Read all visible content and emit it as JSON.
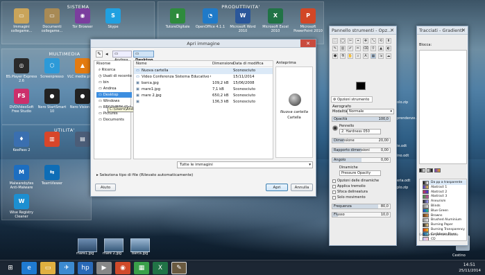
{
  "desktop": {
    "groups": {
      "sistema": "SISTEMA",
      "produttivita": "PRODUTTIVITA'",
      "multimedia": "MULTIMEDIA",
      "utilita": "UTILITA'"
    },
    "icons": [
      {
        "label": "Immagini collegame...",
        "color": "#c9a45a",
        "glyph": "▭"
      },
      {
        "label": "Documenti collegame...",
        "color": "#a88a55",
        "glyph": "▭"
      },
      {
        "label": "Tor Browser",
        "color": "#7b3e9e",
        "glyph": "◉"
      },
      {
        "label": "Skype",
        "color": "#21a0e0",
        "glyph": "S"
      },
      {
        "label": "TutoreDigitale",
        "color": "#2e8b3d",
        "glyph": "▮"
      },
      {
        "label": "OpenOffice 4.1.1",
        "color": "#1f7ac8",
        "glyph": "◔"
      },
      {
        "label": "Microsoft Word 2010",
        "color": "#2b579a",
        "glyph": "W"
      },
      {
        "label": "Microsoft Excel 2010",
        "color": "#217346",
        "glyph": "X"
      },
      {
        "label": "Microsoft PowerPoint 2010",
        "color": "#d24726",
        "glyph": "P"
      },
      {
        "label": "BS.Player Express 2.6",
        "color": "#2a2a2a",
        "glyph": "◎"
      },
      {
        "label": "Screenpresso",
        "color": "#2d9ad8",
        "glyph": "⬡"
      },
      {
        "label": "VLC media player",
        "color": "#e47b10",
        "glyph": "▲"
      },
      {
        "label": "DVDVideoSoft Free Studio",
        "color": "#cc2f6b",
        "glyph": "FS"
      },
      {
        "label": "Nero StartSmart 10",
        "color": "#222",
        "glyph": "●"
      },
      {
        "label": "Nero Vision 10",
        "color": "#222",
        "glyph": "●"
      },
      {
        "label": "KeePass 2",
        "color": "#3a6fb0",
        "glyph": "♦"
      },
      {
        "label": "",
        "color": "#d8462a",
        "glyph": "▥"
      },
      {
        "label": "",
        "color": "#4b5d78",
        "glyph": "▤"
      },
      {
        "label": "Malwarebytes Anti-Malware",
        "color": "#1d6ec0",
        "glyph": "M"
      },
      {
        "label": "TeamViewer",
        "color": "#0e6db6",
        "glyph": "⇆"
      },
      {
        "label": "Wise Registry Cleaner",
        "color": "#1c8fd1",
        "glyph": "W"
      }
    ],
    "right_files": [
      "olo.zip",
      "prendenze.odt",
      "ie.odt",
      "ino.odt",
      "eria.odt",
      "plo.zip"
    ],
    "bottom_files": [
      {
        "name": "mare1.jpg"
      },
      {
        "name": "mare 2.jpg"
      },
      {
        "name": "barca.jpg"
      }
    ],
    "cestino": "Cestino"
  },
  "dialog": {
    "title": "Apri immagine",
    "path": [
      "Andrea",
      "Desktop"
    ],
    "places_header": "Risorse",
    "places": [
      "Ricerca",
      "Usati di recente",
      "bin",
      "Andrea",
      "Desktop",
      "Windows",
      "RECOVERY (D:)",
      "Pictures",
      "Documents"
    ],
    "tooltip": "C:\\Users\\Andrea\\Desktop",
    "columns": {
      "name": "Nome",
      "size": "Dimensione",
      "date": "Data di modifica"
    },
    "files": [
      {
        "name": "Nuova cartella",
        "size": "",
        "date": "Sconosciuto",
        "icon": "folder"
      },
      {
        "name": "Video Conferenza Sistema Educativo Gen...",
        "size": "",
        "date": "15/11/2014",
        "icon": "folder"
      },
      {
        "name": "barca.jpg",
        "size": "109,2 kB",
        "date": "15/06/2008",
        "icon": "img"
      },
      {
        "name": "mare1.jpg",
        "size": "7,1 kB",
        "date": "Sconosciuto",
        "icon": "img"
      },
      {
        "name": "mare 2.jpg",
        "size": "650,2 kB",
        "date": "Sconosciuto",
        "icon": "img"
      },
      {
        "name": "",
        "size": "136,3 kB",
        "date": "Sconosciuto",
        "icon": "img"
      }
    ],
    "selected_row": 0,
    "preview_header": "Anteprima",
    "preview_name": "Nuova cartella",
    "preview_type": "Cartella",
    "filter": "Tutte le immagini",
    "select_type": "Seleziona tipo di file (Rilevato automaticamente)",
    "help": "Aiuto",
    "open": "Apri",
    "cancel": "Annulla"
  },
  "toolbox": {
    "title": "Pannello strumenti - Opz...",
    "tab": "Opzioni strumento",
    "tool_name": "Aerografo",
    "mode_label": "Modalità:",
    "mode_value": "Normale",
    "opacity_label": "Opacità",
    "opacity_value": "100,0",
    "brush_label": "Pennello",
    "brush_value": "2. Hardness 050",
    "size_label": "Dimensione",
    "size_value": "20,00",
    "ratio_label": "Rapporto dimensioni",
    "ratio_value": "0,00",
    "angle_label": "Angolo",
    "angle_value": "0,00",
    "dynamics_label": "Dinamiche",
    "dynamics_value": "Pressure Opacity",
    "options": [
      "Opzioni delle dinamiche",
      "Applica tremolio",
      "Sfoca delineatura",
      "Solo movimento"
    ],
    "rate_label": "Frequenza",
    "rate_value": "80,0",
    "flow_label": "Flusso",
    "flow_value": "10,0",
    "fill_percent": {
      "opacity": 100,
      "size": 20,
      "ratio": 50,
      "angle": 50,
      "rate": 80,
      "flow": 10
    }
  },
  "paths": {
    "title": "Tracciati - Gradienti",
    "filter_label": "Blocca:",
    "gradients": [
      {
        "name": "Da pp a trasparente",
        "c1": "#000000",
        "c2": "#ffffff"
      },
      {
        "name": "Abstract 1",
        "c1": "#3a2fd0",
        "c2": "#e8c040"
      },
      {
        "name": "Abstract 2",
        "c1": "#d03050",
        "c2": "#3040d0"
      },
      {
        "name": "Abstract 3",
        "c1": "#30a040",
        "c2": "#d040a0"
      },
      {
        "name": "Aneurism",
        "c1": "#202020",
        "c2": "#a0a0ff"
      },
      {
        "name": "Blinds",
        "c1": "#808080",
        "c2": "#e0e0e0"
      },
      {
        "name": "Blue Green",
        "c1": "#2040d0",
        "c2": "#20c080"
      },
      {
        "name": "Browns",
        "c1": "#6a3a10",
        "c2": "#d09050"
      },
      {
        "name": "Brushed Aluminium",
        "c1": "#909090",
        "c2": "#e8e8e8"
      },
      {
        "name": "Burning Paper",
        "c1": "#202020",
        "c2": "#f0d090"
      },
      {
        "name": "Burning Transparency",
        "c1": "#d03010",
        "c2": "#f0c020"
      },
      {
        "name": "Caribbean Blues",
        "c1": "#0050a0",
        "c2": "#80e0f0"
      },
      {
        "name": "CD",
        "c1": "#c0c0ff",
        "c2": "#ffc0c0"
      }
    ],
    "footer": "Gradiente personalizzato"
  },
  "taskbar": {
    "time": "14:51",
    "date": "25/11/2014",
    "items": [
      "windows-start",
      "internet-explorer",
      "file-explorer",
      "feather-app",
      "hp-app",
      "media-app",
      "chrome",
      "store",
      "excel",
      "gimp"
    ]
  }
}
